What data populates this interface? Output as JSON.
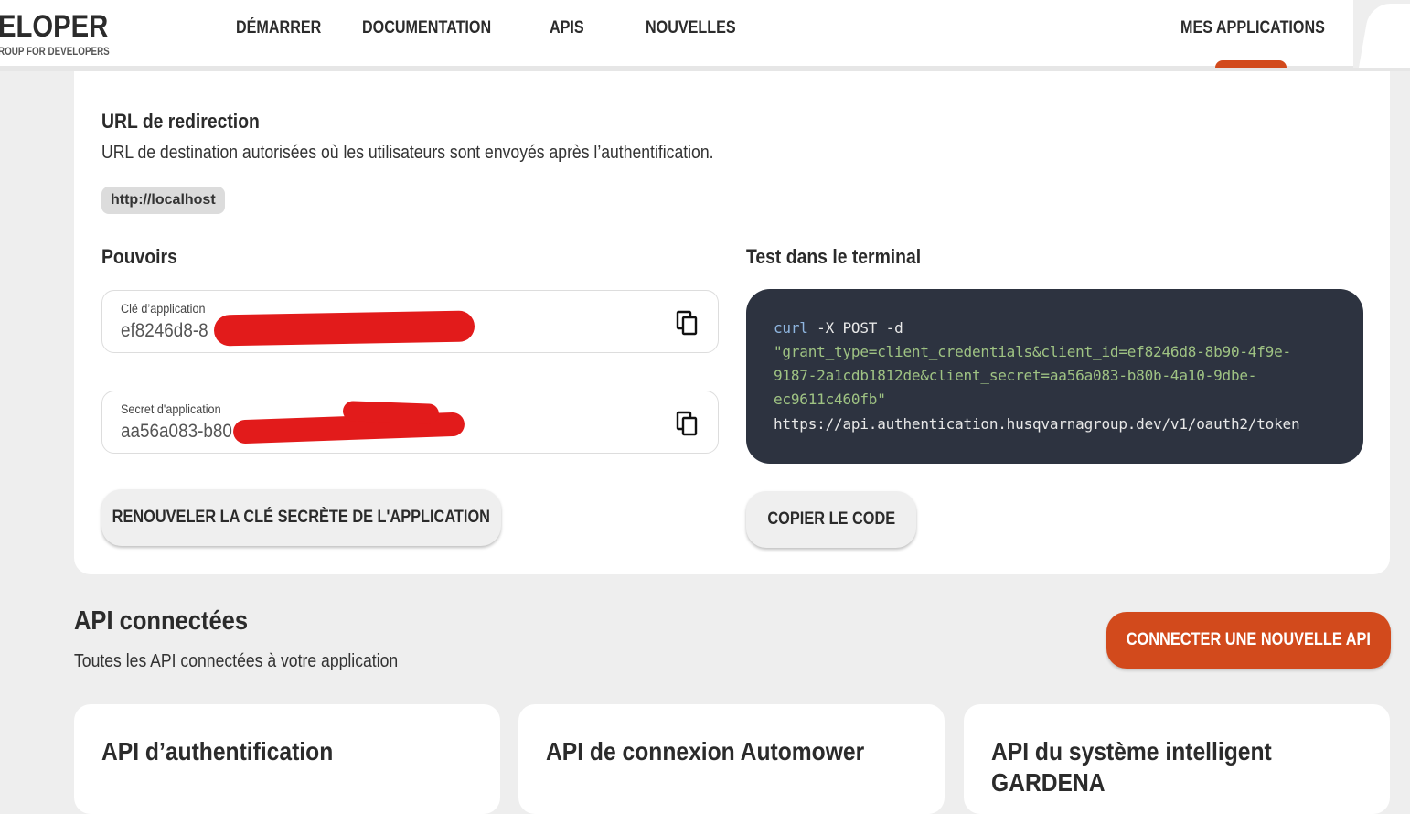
{
  "header": {
    "logo_text": "ELOPER",
    "logo_subtext": "ROUP FOR DEVELOPERS",
    "nav": [
      {
        "label": "DÉMARRER"
      },
      {
        "label": "DOCUMENTATION"
      },
      {
        "label": "APIS"
      },
      {
        "label": "NOUVELLES"
      }
    ],
    "my_apps_label": "MES APPLICATIONS"
  },
  "redirect": {
    "title": "URL de redirection",
    "description": "URL de destination autorisées où les utilisateurs sont envoyés après l’authentification.",
    "url_chip": "http://localhost"
  },
  "credentials": {
    "title": "Pouvoirs",
    "app_key_label": "Clé d’application",
    "app_key_value": "ef8246d8-8",
    "app_secret_label": "Secret d'application",
    "app_secret_value": "aa56a083-b80",
    "renew_button": "RENOUVELER LA CLÉ SECRÈTE DE L'APPLICATION"
  },
  "terminal": {
    "title": "Test dans le terminal",
    "cmd": "curl",
    "cmd_args": " -X POST -d",
    "lines": [
      "\"grant_type=client_credentials&client_id=ef8246d8-8b90-4f9e-",
      "9187-2a1cdb1812de&client_secret=aa56a083-b80b-4a10-9dbe-",
      "ec9611c460fb\""
    ],
    "url_line": " https://api.authentication.husqvarnagroup.dev/v1/oauth2/token",
    "copy_button": "COPIER LE CODE"
  },
  "connected": {
    "title": "API connectées",
    "description": "Toutes les API connectées à votre application",
    "connect_button": "CONNECTER UNE NOUVELLE API",
    "apis": [
      {
        "title": "API d’authentification"
      },
      {
        "title": "API de connexion Automower"
      },
      {
        "title": "API du système intelligent GARDENA"
      }
    ]
  },
  "colors": {
    "accent": "#d24a1c",
    "terminal_bg": "#2d3340",
    "redaction": "#e21b1b"
  }
}
